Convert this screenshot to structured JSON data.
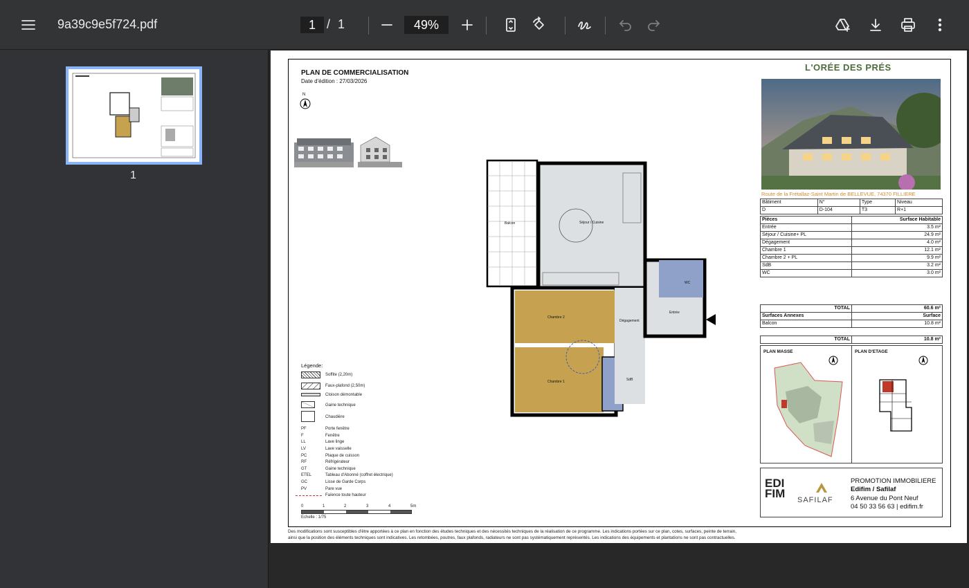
{
  "toolbar": {
    "file_name": "9a39c9e5f724.pdf",
    "current_page": "1",
    "page_separator": "/",
    "total_pages": "1",
    "zoom": "49%"
  },
  "icons": [
    "menu-icon",
    "zoom-out-icon",
    "zoom-in-icon",
    "fit-page-icon",
    "rotate-icon",
    "annotate-icon",
    "undo-icon",
    "redo-icon",
    "add-to-drive-icon",
    "download-icon",
    "print-icon",
    "more-icon"
  ],
  "sidebar": {
    "thumbnail_label": "1"
  },
  "document": {
    "plan_title": "PLAN DE COMMERCIALISATION",
    "edition_date": "Date d'édition :  27/03/2026",
    "north": "N",
    "brand": "L'ORÉE DES PRÉS",
    "address": "Route de la Frétallaz-Saint Martin de BELLEVUE, 74370 FILLIERE",
    "info_headers": [
      "Bâtiment",
      "N°",
      "Type",
      "Niveau"
    ],
    "info_values": [
      "D",
      "D-104",
      "T3",
      "R+1"
    ],
    "rooms_header": [
      "Pièces",
      "Surface Habitable"
    ],
    "rooms": [
      [
        "Entrée",
        "3.5 m²"
      ],
      [
        "Séjour / Cuisine+ PL",
        "24.9 m²"
      ],
      [
        "Dégagement",
        "4.0 m²"
      ],
      [
        "Chambre 1",
        "12.1 m²"
      ],
      [
        "Chambre 2 + PL",
        "9.9 m²"
      ],
      [
        "SdB",
        "3.2 m²"
      ],
      [
        "WC",
        "3.0 m²"
      ]
    ],
    "total_label": "TOTAL",
    "total_value": "60.6 m²",
    "annex_header": [
      "Surfaces Annexes",
      "Surface"
    ],
    "annexes": [
      [
        "Balcon",
        "10.8 m²"
      ]
    ],
    "annex_total_value": "10.8 m²",
    "plan_masse": "PLAN MASSE",
    "plan_etage": "PLAN D'ETAGE",
    "promoter": {
      "logo1": "EDI FIM",
      "logo2": "SAFILAF",
      "line1": "PROMOTION IMMOBILIERE",
      "line2": "Edifim / Safilaf",
      "line3": "6 Avenue du Pont Neuf",
      "line4": "04 50 33 56 63 | edifim.fr"
    },
    "legend_title": "Légende:",
    "legend_swatches": [
      "Soffite (2,20m)",
      "Faux-plafond (2,50m)",
      "Cloison démontable",
      "Gaine technique",
      "Chaudière"
    ],
    "legend_codes": [
      [
        "PF",
        "Porte fenêtre"
      ],
      [
        "F",
        "Fenêtre"
      ],
      [
        "LL",
        "Lave linge"
      ],
      [
        "LV",
        "Lave vaisselle"
      ],
      [
        "PC",
        "Plaque de cuisson"
      ],
      [
        "RF",
        "Réfrigérateur"
      ],
      [
        "GT",
        "Gaine technique"
      ],
      [
        "ETEL",
        "Tableau d'Abonné (coffret électrique)"
      ],
      [
        "GC",
        "Lisse de Garde Corps"
      ],
      [
        "PV",
        "Pare vue"
      ]
    ],
    "legend_faience": "Faïence toute hauteur",
    "scale_ticks": [
      "0",
      "1",
      "2",
      "3",
      "4",
      "5m"
    ],
    "scale_label": "Echelle : 1/75",
    "room_labels": {
      "sejour": "Séjour / Cuisine",
      "balcon": "Balcon",
      "chambre2": "Chambre 2",
      "chambre1": "Chambre 1",
      "degagement": "Dégagement",
      "entree": "Entrée",
      "sdb": "SdB",
      "wc": "WC"
    },
    "footer_line1": "Des modifications sont susceptibles d'être apportées à ce plan en fonction des études techniques et des nécessités techniques de la réalisation de ce programme.   Les indications portées sur ce plan, cotes, surfaces, peinte de terrain,",
    "footer_line2": "ainsi que la position des éléments techniques sont indicatives.  Les retombées, poutres, faux plafonds, radiateurs ne sont pas systématiquement représentés. Les indications des équipements et plantations ne sont pas contractuelles."
  },
  "colors": {
    "toolbar": "#333436",
    "sidebar": "#323336",
    "viewer": "#282828",
    "accent": "#8ab4f8",
    "brand_green": "#4d6b3a",
    "address_orange": "#d08a2e",
    "bedroom_fill": "#c5a150",
    "bath_fill": "#8fa1c9"
  }
}
